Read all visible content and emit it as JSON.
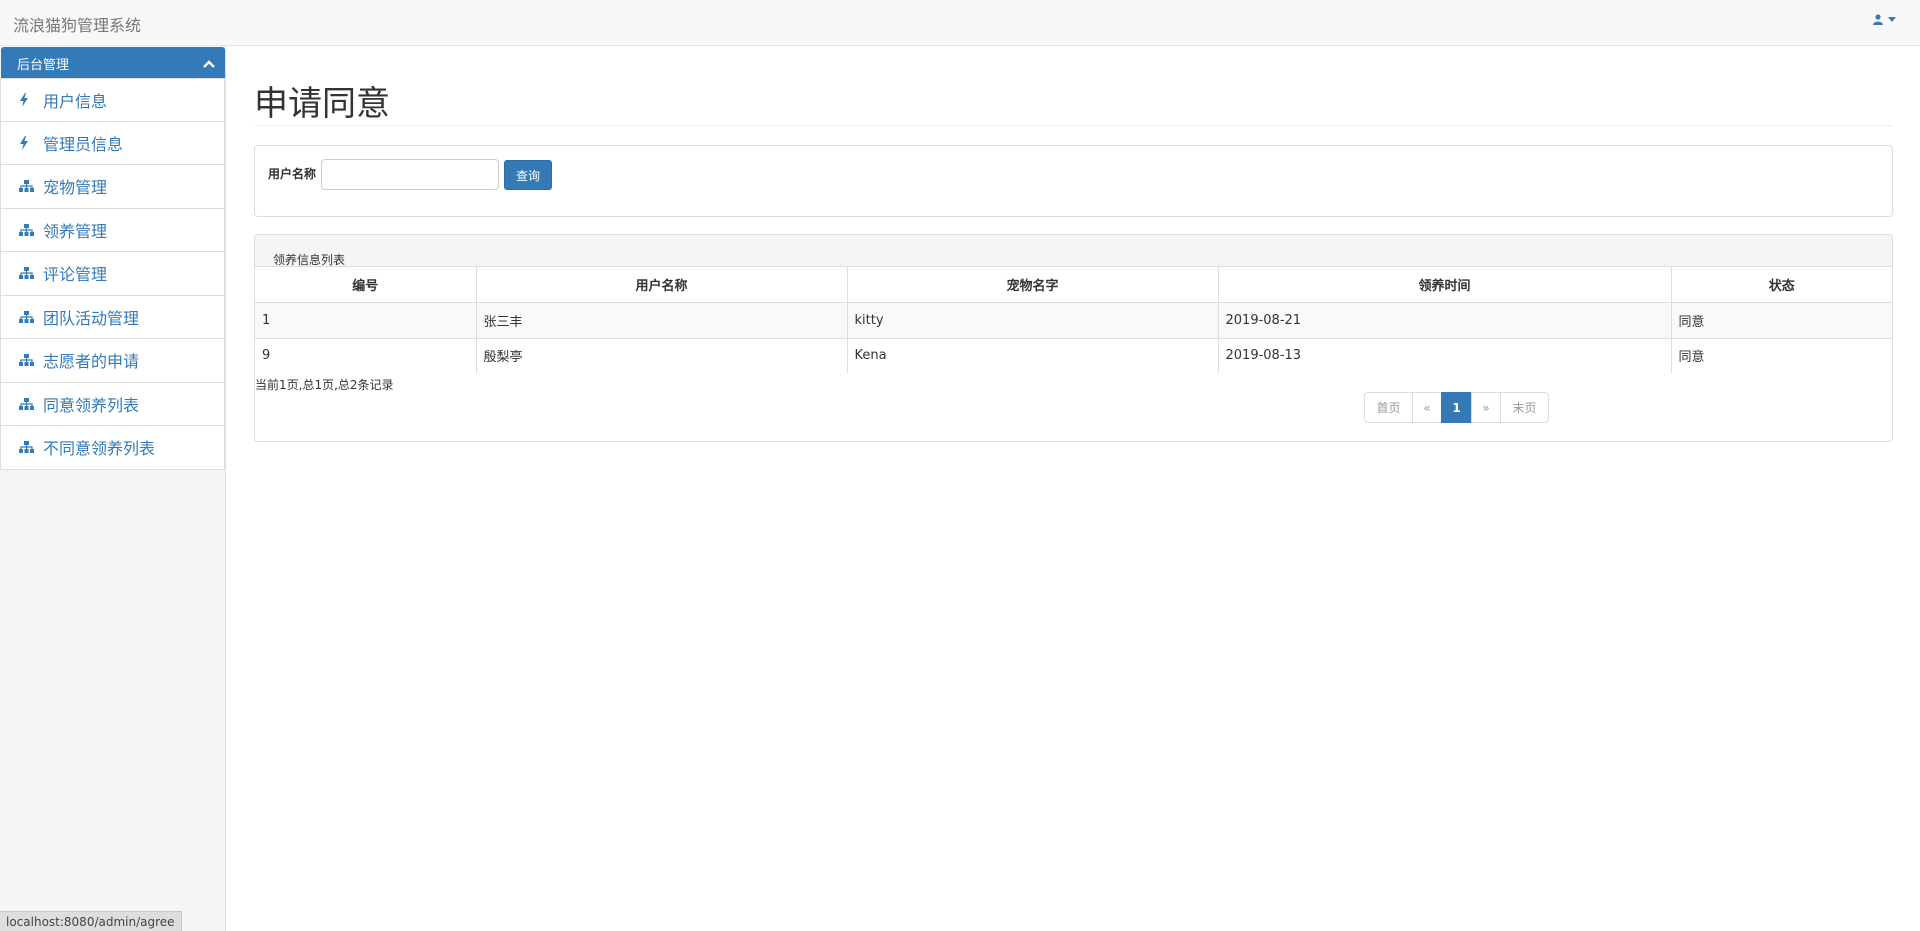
{
  "app": {
    "title": "流浪猫狗管理系统"
  },
  "user_menu": {
    "icon": "user-icon"
  },
  "sidebar": {
    "header": "后台管理",
    "items": [
      {
        "label": "用户信息",
        "icon": "bolt-icon"
      },
      {
        "label": "管理员信息",
        "icon": "bolt-icon"
      },
      {
        "label": "宠物管理",
        "icon": "sitemap-icon"
      },
      {
        "label": "领养管理",
        "icon": "sitemap-icon"
      },
      {
        "label": "评论管理",
        "icon": "sitemap-icon"
      },
      {
        "label": "团队活动管理",
        "icon": "sitemap-icon"
      },
      {
        "label": "志愿者的申请",
        "icon": "sitemap-icon"
      },
      {
        "label": "同意领养列表",
        "icon": "sitemap-icon"
      },
      {
        "label": "不同意领养列表",
        "icon": "sitemap-icon"
      }
    ]
  },
  "page": {
    "title": "申请同意"
  },
  "search": {
    "label": "用户名称",
    "value": "",
    "button": "查询"
  },
  "list": {
    "title": "领养信息列表",
    "columns": [
      "编号",
      "用户名称",
      "宠物名字",
      "领养时间",
      "状态"
    ],
    "rows": [
      [
        "1",
        "张三丰",
        "kitty",
        "2019-08-21",
        "同意"
      ],
      [
        "9",
        "殷梨亭",
        "Kena",
        "2019-08-13",
        "同意"
      ]
    ],
    "page_info": "当前1页,总1页,总2条记录"
  },
  "pagination": {
    "first": "首页",
    "prev": "«",
    "current": "1",
    "next": "»",
    "last": "末页"
  },
  "status_bar": {
    "url": "localhost:8080/admin/agree"
  },
  "colors": {
    "primary": "#337ab7",
    "navbar_bg": "#f8f8f8",
    "sidebar_bg": "#f5f5f5"
  }
}
